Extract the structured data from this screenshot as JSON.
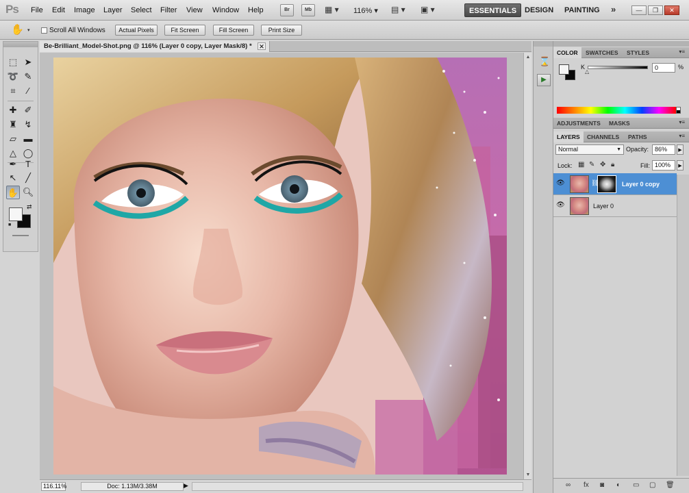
{
  "app": {
    "logo": "Ps",
    "menu": [
      "File",
      "Edit",
      "Image",
      "Layer",
      "Select",
      "Filter",
      "View",
      "Window",
      "Help"
    ],
    "bridge_label": "Br",
    "minibridge_label": "Mb",
    "zoom": "116%",
    "workspaces": [
      "ESSENTIALS",
      "DESIGN",
      "PAINTING"
    ],
    "more_label": "»"
  },
  "options_bar": {
    "scroll_all_label": "Scroll All Windows",
    "buttons": [
      "Actual Pixels",
      "Fit Screen",
      "Fill Screen",
      "Print Size"
    ]
  },
  "document": {
    "tab_title": "Be-Brilliant_Model-Shot.png @ 116% (Layer 0 copy, Layer Mask/8) *",
    "close_label": "✕"
  },
  "status": {
    "zoom": "116.11%",
    "doc_size": "Doc: 1.13M/3.38M"
  },
  "color_panel": {
    "tabs": [
      "COLOR",
      "SWATCHES",
      "STYLES"
    ],
    "channel_label": "K",
    "channel_value": "0",
    "unit": "%"
  },
  "adjustments_panel": {
    "tabs": [
      "ADJUSTMENTS",
      "MASKS"
    ]
  },
  "layers_panel": {
    "tabs": [
      "LAYERS",
      "CHANNELS",
      "PATHS"
    ],
    "blend_mode": "Normal",
    "opacity_label": "Opacity:",
    "opacity": "86%",
    "lock_label": "Lock:",
    "fill_label": "Fill:",
    "fill": "100%",
    "layers": [
      {
        "name": "Layer 0 copy",
        "selected": true,
        "has_mask": true
      },
      {
        "name": "Layer 0",
        "selected": false,
        "has_mask": false
      }
    ]
  }
}
